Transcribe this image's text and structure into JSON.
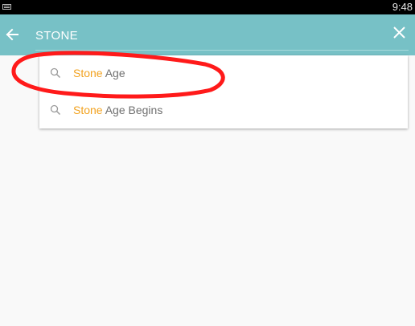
{
  "status_bar": {
    "time": "9:48",
    "left_icon": "keyboard-icon"
  },
  "search": {
    "query": "STONE",
    "back_icon": "arrow-left-icon",
    "clear_icon": "close-icon"
  },
  "suggestions": [
    {
      "highlight": "Stone",
      "rest": " Age",
      "icon": "search-icon"
    },
    {
      "highlight": "Stone",
      "rest": " Age Begins",
      "icon": "search-icon"
    }
  ],
  "colors": {
    "toolbar": "#77c1c6",
    "highlight": "#f2a21f",
    "annotation": "#ff1a1a"
  }
}
